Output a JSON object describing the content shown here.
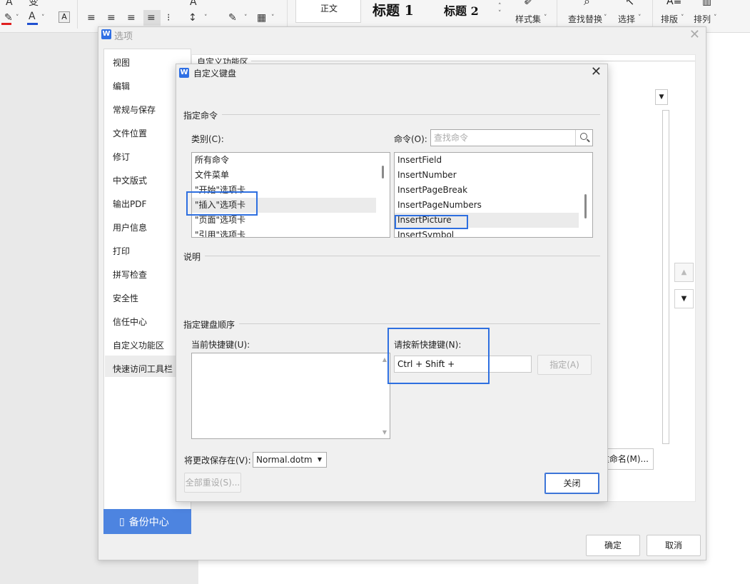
{
  "ribbon": {
    "glyphs": [
      "A",
      "变",
      "A",
      "≡",
      "≡",
      "≡",
      "≡",
      "⁝",
      "A",
      "↕",
      "✎",
      "A",
      "▦"
    ],
    "styles": [
      "正文",
      "标题 1",
      "标题 2"
    ],
    "style_set_label": "样式集",
    "find_replace_label": "查找替换",
    "select_label": "选择",
    "layout_label": "排版",
    "arrange_label": "排列"
  },
  "options_dialog": {
    "title": "选项",
    "nav_items": [
      "视图",
      "编辑",
      "常规与保存",
      "文件位置",
      "修订",
      "中文版式",
      "输出PDF",
      "用户信息",
      "打印",
      "拼写检查",
      "安全性",
      "信任中心",
      "自定义功能区",
      "快速访问工具栏"
    ],
    "active_nav": "自定义功能区",
    "backup_label": "备份中心",
    "section_title": "自定义功能区",
    "rename_label": "重命名(M)...",
    "ok_label": "确定",
    "cancel_label": "取消"
  },
  "keyboard_dialog": {
    "title": "自定义键盘",
    "assign_group": "指定命令",
    "category_label": "类别(C):",
    "categories": [
      "所有命令",
      "文件菜单",
      "\"开始\"选项卡",
      "\"插入\"选项卡",
      "\"页面\"选项卡",
      "\"引用\"选项卡"
    ],
    "selected_category": "\"插入\"选项卡",
    "command_label": "命令(O):",
    "search_placeholder": "查找命令",
    "commands": [
      "InsertField",
      "InsertNumber",
      "InsertPageBreak",
      "InsertPageNumbers",
      "InsertPicture",
      "InsertSymbol"
    ],
    "selected_command": "InsertPicture",
    "description_group": "说明",
    "key_sequence_group": "指定键盘顺序",
    "current_keys_label": "当前快捷键(U):",
    "new_key_label": "请按新快捷键(N):",
    "new_key_value": "Ctrl + Shift +",
    "assign_button": "指定(A)",
    "save_in_label": "将更改保存在(V):",
    "save_in_value": "Normal.dotm",
    "reset_all_button": "全部重设(S)...",
    "close_button": "关闭"
  },
  "colors": {
    "accent": "#2e6fe0",
    "backup_bg": "#4d84e0",
    "font_color_red": "#e02020",
    "font_color_blue": "#2050d0"
  }
}
